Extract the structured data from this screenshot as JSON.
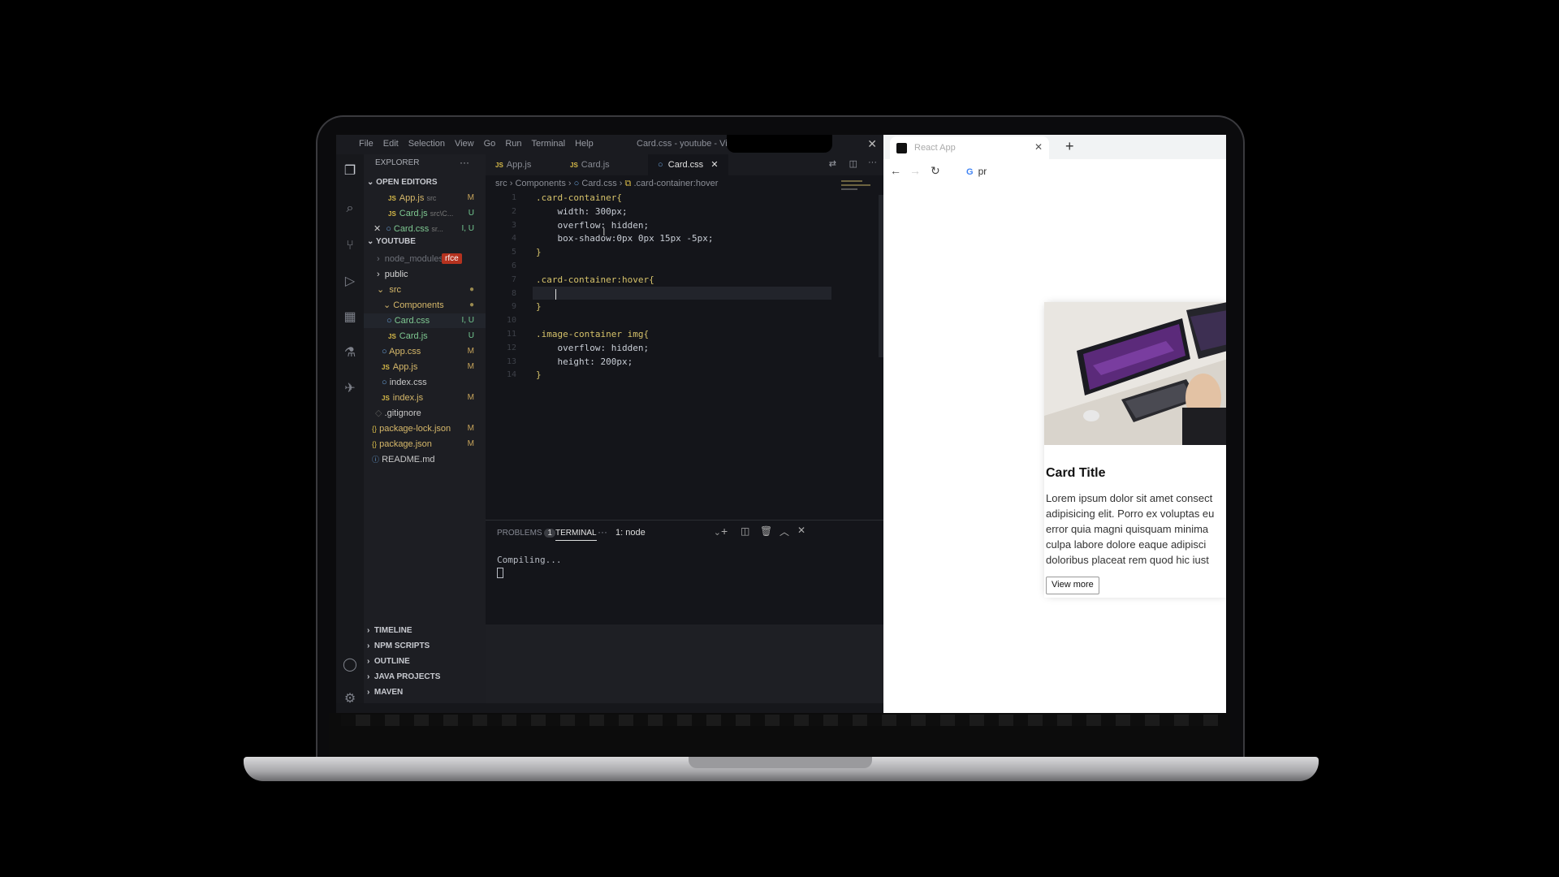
{
  "vscode": {
    "menu": [
      "File",
      "Edit",
      "Selection",
      "View",
      "Go",
      "Run",
      "Terminal",
      "Help"
    ],
    "window_title": "Card.css - youtube - Vis",
    "explorer_title": "EXPLORER",
    "open_editors_title": "OPEN EDITORS",
    "open_editors": [
      {
        "name": "App.js",
        "desc": "src",
        "badge": "M"
      },
      {
        "name": "Card.js",
        "desc": "src\\C...",
        "badge": "U"
      },
      {
        "name": "Card.css",
        "desc": "sr...",
        "badge": "I, U"
      }
    ],
    "workspace_title": "YOUTUBE",
    "tree": [
      {
        "name": "node_modules",
        "type": "folder"
      },
      {
        "name": "public",
        "type": "folder"
      },
      {
        "name": "src",
        "type": "folder"
      },
      {
        "name": "Components",
        "type": "folder"
      },
      {
        "name": "Card.css",
        "badge": "I, U"
      },
      {
        "name": "Card.js",
        "badge": "U"
      },
      {
        "name": "App.css",
        "badge": "M"
      },
      {
        "name": "App.js",
        "badge": "M"
      },
      {
        "name": "index.css",
        "badge": ""
      },
      {
        "name": "index.js",
        "badge": "M"
      },
      {
        "name": ".gitignore",
        "badge": ""
      },
      {
        "name": "package-lock.json",
        "badge": "M"
      },
      {
        "name": "package.json",
        "badge": "M"
      },
      {
        "name": "README.md",
        "badge": ""
      }
    ],
    "snippet_tag": "rfce",
    "tabs": [
      "App.js",
      "Card.js",
      "Card.css"
    ],
    "breadcrumb": [
      "src",
      "Components",
      "Card.css",
      ".card-container:hover"
    ],
    "code_lines": [
      ".card-container{",
      "    width: 300px;",
      "    overflow: hidden;",
      "    box-shadow:0px 0px 15px -5px;",
      "}",
      "",
      ".card-container:hover{",
      "    ",
      "}",
      "",
      ".image-container img{",
      "    overflow: hidden;",
      "    height: 200px;",
      "}"
    ],
    "panel": {
      "problems_label": "PROBLEMS",
      "problems_count": "1",
      "terminal_label": "TERMINAL",
      "terminal_select": "1: node",
      "output": "Compiling..."
    },
    "bottom_sections": [
      "TIMELINE",
      "NPM SCRIPTS",
      "OUTLINE",
      "JAVA PROJECTS",
      "MAVEN"
    ]
  },
  "browser": {
    "tab_title": "React App",
    "url_text": "pr",
    "card": {
      "title": "Card Title",
      "body_lines": [
        "Lorem ipsum dolor sit amet consect",
        "adipisicing elit. Porro ex voluptas eu",
        "error quia magni quisquam minima",
        "culpa labore dolore eaque adipisci",
        "doloribus placeat rem quod hic iust"
      ],
      "button_label": "View more"
    }
  }
}
